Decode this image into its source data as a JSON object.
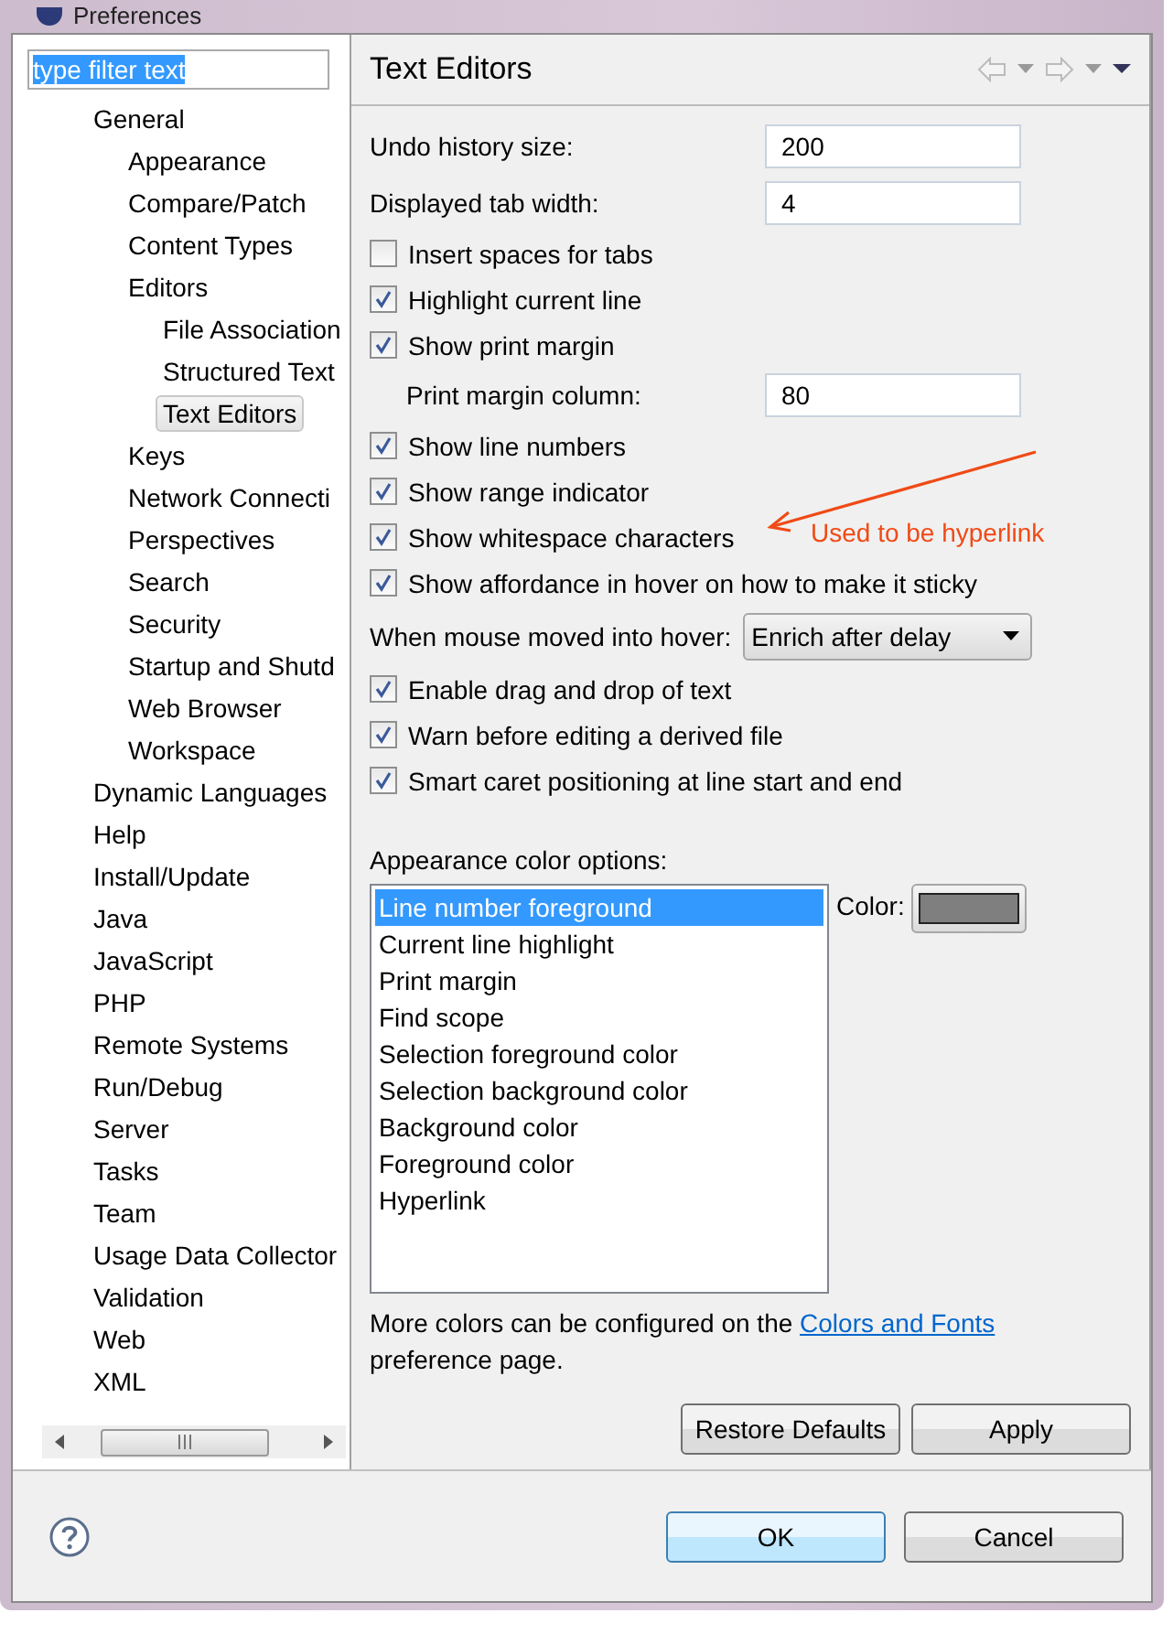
{
  "window": {
    "title": "Preferences"
  },
  "filter": {
    "value": "type filter text",
    "text_selected": true
  },
  "tree": [
    {
      "label": "General",
      "selected": false,
      "children": [
        {
          "label": "Appearance",
          "selected": false
        },
        {
          "label": "Compare/Patch",
          "selected": false
        },
        {
          "label": "Content Types",
          "selected": false
        },
        {
          "label": "Editors",
          "selected": false,
          "children": [
            {
              "label": "File Association",
              "selected": false
            },
            {
              "label": "Structured Text",
              "selected": false
            },
            {
              "label": "Text Editors",
              "selected": true
            }
          ]
        },
        {
          "label": "Keys",
          "selected": false
        },
        {
          "label": "Network Connecti",
          "selected": false
        },
        {
          "label": "Perspectives",
          "selected": false
        },
        {
          "label": "Search",
          "selected": false
        },
        {
          "label": "Security",
          "selected": false
        },
        {
          "label": "Startup and Shutd",
          "selected": false
        },
        {
          "label": "Web Browser",
          "selected": false
        },
        {
          "label": "Workspace",
          "selected": false
        }
      ]
    },
    {
      "label": "Dynamic Languages",
      "selected": false
    },
    {
      "label": "Help",
      "selected": false
    },
    {
      "label": "Install/Update",
      "selected": false
    },
    {
      "label": "Java",
      "selected": false
    },
    {
      "label": "JavaScript",
      "selected": false
    },
    {
      "label": "PHP",
      "selected": false
    },
    {
      "label": "Remote Systems",
      "selected": false
    },
    {
      "label": "Run/Debug",
      "selected": false
    },
    {
      "label": "Server",
      "selected": false
    },
    {
      "label": "Tasks",
      "selected": false
    },
    {
      "label": "Team",
      "selected": false
    },
    {
      "label": "Usage Data Collector",
      "selected": false
    },
    {
      "label": "Validation",
      "selected": false
    },
    {
      "label": "Web",
      "selected": false
    },
    {
      "label": "XML",
      "selected": false
    }
  ],
  "page": {
    "title": "Text Editors",
    "settings": [
      {
        "kind": "input",
        "label": "Undo history size:",
        "value": "200"
      },
      {
        "kind": "input",
        "label": "Displayed tab width:",
        "value": "4"
      },
      {
        "kind": "checkbox",
        "label": "Insert spaces for tabs",
        "checked": false
      },
      {
        "kind": "checkbox",
        "label": "Highlight current line",
        "checked": true
      },
      {
        "kind": "checkbox",
        "label": "Show print margin",
        "checked": true,
        "children": [
          {
            "kind": "input",
            "label": "Print margin column:",
            "value": "80"
          }
        ]
      },
      {
        "kind": "checkbox",
        "label": "Show line numbers",
        "checked": true
      },
      {
        "kind": "checkbox",
        "label": "Show range indicator",
        "checked": true
      },
      {
        "kind": "checkbox",
        "label": "Show whitespace characters",
        "checked": true
      },
      {
        "kind": "checkbox",
        "label": "Show affordance in hover on how to make it sticky",
        "checked": true
      },
      {
        "kind": "combo",
        "label": "When mouse moved into hover:",
        "value": "Enrich after delay"
      },
      {
        "kind": "checkbox",
        "label": "Enable drag and drop of text",
        "checked": true
      },
      {
        "kind": "checkbox",
        "label": "Warn before editing a derived file",
        "checked": true
      },
      {
        "kind": "checkbox",
        "label": "Smart caret positioning at line start and end",
        "checked": true
      }
    ],
    "color_options": {
      "label": "Appearance color options:",
      "items": [
        {
          "label": "Line number foreground",
          "selected": true
        },
        {
          "label": "Current line highlight",
          "selected": false
        },
        {
          "label": "Print margin",
          "selected": false
        },
        {
          "label": "Find scope",
          "selected": false
        },
        {
          "label": "Selection foreground color",
          "selected": false
        },
        {
          "label": "Selection background color",
          "selected": false
        },
        {
          "label": "Background color",
          "selected": false
        },
        {
          "label": "Foreground color",
          "selected": false
        },
        {
          "label": "Hyperlink",
          "selected": false
        }
      ],
      "color_label": "Color:",
      "color": "#7f7f7f"
    },
    "note": {
      "text": "More colors can be configured on the",
      "link": "Colors and Fonts",
      "text_after": "preference page."
    },
    "page_buttons": [
      "Restore Defaults",
      "Apply"
    ]
  },
  "annotation": {
    "text": "Used to be hyperlink"
  },
  "dialog_buttons": [
    {
      "label": "OK",
      "default": true
    },
    {
      "label": "Cancel",
      "default": false
    }
  ]
}
